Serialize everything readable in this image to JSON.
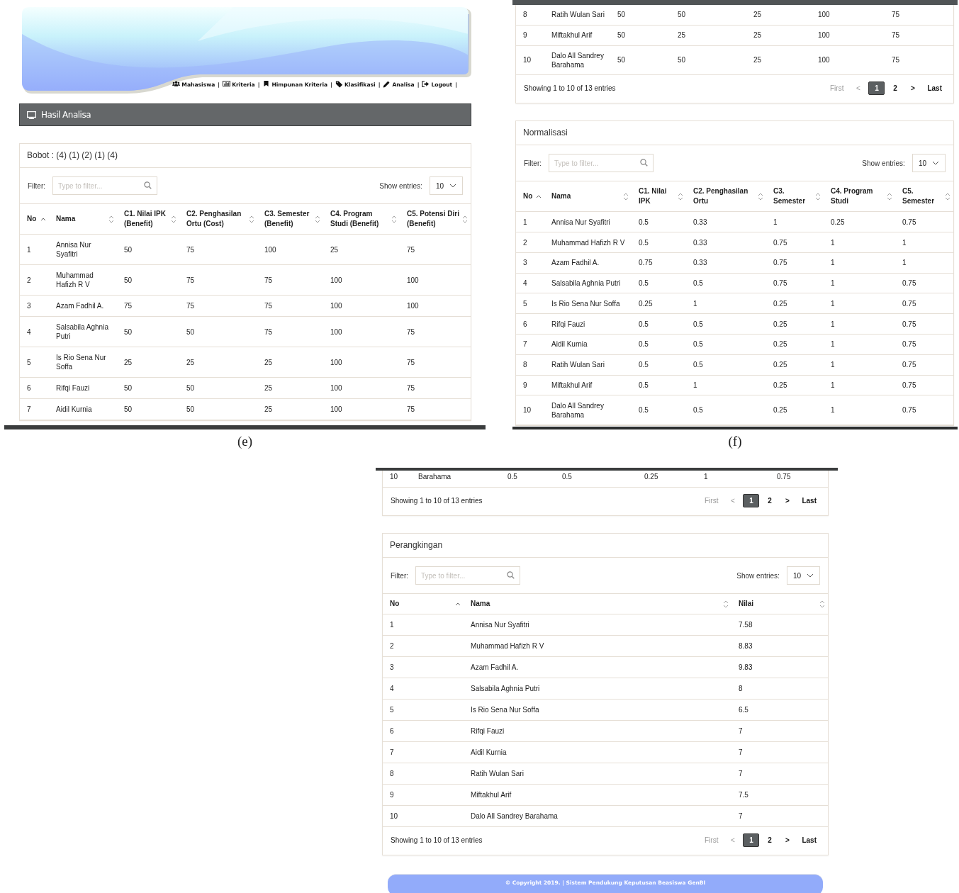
{
  "panels": [
    {
      "caption": "(e)",
      "banner": {
        "nav": {
          "separator": "|",
          "items": [
            {
              "label": "Mahasiswa"
            },
            {
              "label": "Kriteria"
            },
            {
              "label": "Himpunan Kriteria"
            },
            {
              "label": "Klasifikasi"
            },
            {
              "label": "Analisa"
            },
            {
              "label": "Logout"
            }
          ]
        }
      },
      "title_bar": {
        "label": "Hasil Analisa"
      },
      "cards": [
        {
          "title": "Bobot : (4) (1) (2) (1) (4)",
          "filter": {
            "label": "Filter:",
            "placeholder": "Type to filter..."
          },
          "entries": {
            "label": "Show entries:",
            "value": "10"
          },
          "table": {
            "columns": [
              {
                "label": "No",
                "sorted": true
              },
              {
                "label": "Nama",
                "sorted": false
              },
              {
                "label": "C1. Nilai IPK (Benefit)",
                "sorted": false
              },
              {
                "label": "C2. Penghasilan Ortu (Cost)",
                "sorted": false
              },
              {
                "label": "C3. Semester (Benefit)",
                "sorted": false
              },
              {
                "label": "C4. Program Studi (Benefit)",
                "sorted": false
              },
              {
                "label": "C5. Potensi Diri (Benefit)",
                "sorted": false
              }
            ],
            "rows": [
              [
                "1",
                "Annisa Nur Syafitri",
                "50",
                "75",
                "100",
                "25",
                "75"
              ],
              [
                "2",
                "Muhammad Hafizh R V",
                "50",
                "75",
                "75",
                "100",
                "100"
              ],
              [
                "3",
                "Azam Fadhil A.",
                "75",
                "75",
                "75",
                "100",
                "100"
              ],
              [
                "4",
                "Salsabila Aghnia Putri",
                "50",
                "50",
                "75",
                "100",
                "75"
              ],
              [
                "5",
                "Is Rio Sena Nur Soffa",
                "25",
                "25",
                "25",
                "100",
                "75"
              ],
              [
                "6",
                "Rifqi Fauzi",
                "50",
                "50",
                "25",
                "100",
                "75"
              ],
              [
                "7",
                "Aidil Kurnia",
                "50",
                "50",
                "25",
                "100",
                "75"
              ]
            ]
          }
        }
      ]
    },
    {
      "caption": "(f)",
      "cards": [
        {
          "table": {
            "rows": [
              [
                "8",
                "Ratih Wulan Sari",
                "50",
                "50",
                "25",
                "100",
                "75"
              ],
              [
                "9",
                "Miftakhul Arif",
                "50",
                "25",
                "25",
                "100",
                "75"
              ],
              [
                "10",
                "Dalo All Sandrey Barahama",
                "50",
                "50",
                "25",
                "100",
                "75"
              ]
            ]
          },
          "info": "Showing 1 to 10 of 13 entries",
          "pagination": [
            {
              "label": "First",
              "selected": false,
              "disabled": true
            },
            {
              "label": "<",
              "selected": false,
              "disabled": true
            },
            {
              "label": "1",
              "selected": true,
              "disabled": false
            },
            {
              "label": "2",
              "selected": false,
              "disabled": false
            },
            {
              "label": ">",
              "selected": false,
              "disabled": false
            },
            {
              "label": "Last",
              "selected": false,
              "disabled": false
            }
          ]
        },
        {
          "title": "Normalisasi",
          "filter": {
            "label": "Filter:",
            "placeholder": "Type to filter..."
          },
          "entries": {
            "label": "Show entries:",
            "value": "10"
          },
          "table": {
            "columns": [
              {
                "label": "No",
                "sorted": true
              },
              {
                "label": "Nama",
                "sorted": false
              },
              {
                "label": "C1. Nilai IPK",
                "sorted": false
              },
              {
                "label": "C2. Penghasilan Ortu",
                "sorted": false
              },
              {
                "label": "C3. Semester",
                "sorted": false
              },
              {
                "label": "C4. Program Studi",
                "sorted": false
              },
              {
                "label": "C5. Semester",
                "sorted": false
              }
            ],
            "rows": [
              [
                "1",
                "Annisa Nur Syafitri",
                "0.5",
                "0.33",
                "1",
                "0.25",
                "0.75"
              ],
              [
                "2",
                "Muhammad Hafizh R V",
                "0.5",
                "0.33",
                "0.75",
                "1",
                "1"
              ],
              [
                "3",
                "Azam Fadhil A.",
                "0.75",
                "0.33",
                "0.75",
                "1",
                "1"
              ],
              [
                "4",
                "Salsabila Aghnia Putri",
                "0.5",
                "0.5",
                "0.75",
                "1",
                "0.75"
              ],
              [
                "5",
                "Is Rio Sena Nur Soffa",
                "0.25",
                "1",
                "0.25",
                "1",
                "0.75"
              ],
              [
                "6",
                "Rifqi Fauzi",
                "0.5",
                "0.5",
                "0.25",
                "1",
                "0.75"
              ],
              [
                "7",
                "Aidil Kurnia",
                "0.5",
                "0.5",
                "0.25",
                "1",
                "0.75"
              ],
              [
                "8",
                "Ratih Wulan Sari",
                "0.5",
                "0.5",
                "0.25",
                "1",
                "0.75"
              ],
              [
                "9",
                "Miftakhul Arif",
                "0.5",
                "1",
                "0.25",
                "1",
                "0.75"
              ],
              [
                "10",
                "Dalo All Sandrey Barahama",
                "0.5",
                "0.5",
                "0.25",
                "1",
                "0.75"
              ]
            ]
          }
        }
      ]
    },
    {
      "cards": [
        {
          "table": {
            "rows": [
              [
                "10",
                "Barahama",
                "0.5",
                "0.5",
                "0.25",
                "1",
                "0.75"
              ]
            ]
          },
          "info": "Showing 1 to 10 of 13 entries",
          "pagination": [
            {
              "label": "First",
              "selected": false,
              "disabled": true
            },
            {
              "label": "<",
              "selected": false,
              "disabled": true
            },
            {
              "label": "1",
              "selected": true,
              "disabled": false
            },
            {
              "label": "2",
              "selected": false,
              "disabled": false
            },
            {
              "label": ">",
              "selected": false,
              "disabled": false
            },
            {
              "label": "Last",
              "selected": false,
              "disabled": false
            }
          ]
        },
        {
          "title": "Perangkingan",
          "filter": {
            "label": "Filter:",
            "placeholder": "Type to filter..."
          },
          "entries": {
            "label": "Show entries:",
            "value": "10"
          },
          "table": {
            "columns": [
              {
                "label": "No",
                "sorted": true
              },
              {
                "label": "Nama",
                "sorted": false
              },
              {
                "label": "Nilai",
                "sorted": false
              }
            ],
            "rows": [
              [
                "1",
                "Annisa Nur Syafitri",
                "7.58"
              ],
              [
                "2",
                "Muhammad Hafizh R V",
                "8.83"
              ],
              [
                "3",
                "Azam Fadhil A.",
                "9.83"
              ],
              [
                "4",
                "Salsabila Aghnia Putri",
                "8"
              ],
              [
                "5",
                "Is Rio Sena Nur Soffa",
                "6.5"
              ],
              [
                "6",
                "Rifqi Fauzi",
                "7"
              ],
              [
                "7",
                "Aidil Kurnia",
                "7"
              ],
              [
                "8",
                "Ratih Wulan Sari",
                "7"
              ],
              [
                "9",
                "Miftakhul Arif",
                "7.5"
              ],
              [
                "10",
                "Dalo All Sandrey Barahama",
                "7"
              ]
            ]
          },
          "info": "Showing 1 to 10 of 13 entries",
          "pagination": [
            {
              "label": "First",
              "selected": false,
              "disabled": true
            },
            {
              "label": "<",
              "selected": false,
              "disabled": true
            },
            {
              "label": "1",
              "selected": true,
              "disabled": false
            },
            {
              "label": "2",
              "selected": false,
              "disabled": false
            },
            {
              "label": ">",
              "selected": false,
              "disabled": false
            },
            {
              "label": "Last",
              "selected": false,
              "disabled": false
            }
          ]
        }
      ],
      "footer": {
        "text": "© Copyright 2019. | Sistem Pendukung Keputusan Beasiswa GenBI"
      }
    }
  ]
}
